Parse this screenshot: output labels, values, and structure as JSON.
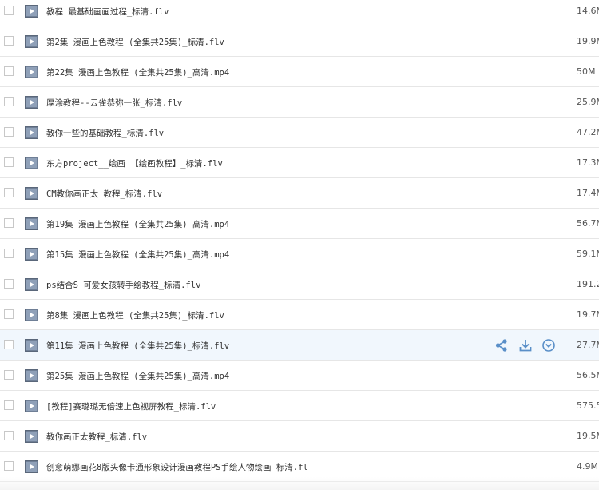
{
  "files": [
    {
      "name": "教程 最基础画画过程_标清.flv",
      "size": "14.6M"
    },
    {
      "name": "第2集 漫画上色教程 (全集共25集)_标清.flv",
      "size": "19.9M"
    },
    {
      "name": "第22集 漫画上色教程 (全集共25集)_高清.mp4",
      "size": "50M"
    },
    {
      "name": "厚涂教程--云雀恭弥一张_标清.flv",
      "size": "25.9M"
    },
    {
      "name": "教你一些的基础教程_标清.flv",
      "size": "47.2M"
    },
    {
      "name": "东方project__绘画 【绘画教程】_标清.flv",
      "size": "17.3M"
    },
    {
      "name": "CM教你画正太 教程_标清.flv",
      "size": "17.4M"
    },
    {
      "name": "第19集 漫画上色教程 (全集共25集)_高清.mp4",
      "size": "56.7M"
    },
    {
      "name": "第15集 漫画上色教程 (全集共25集)_高清.mp4",
      "size": "59.1M"
    },
    {
      "name": "ps结合S 可爱女孩转手绘教程_标清.flv",
      "size": "191.2"
    },
    {
      "name": "第8集 漫画上色教程 (全集共25集)_标清.flv",
      "size": "19.7M"
    },
    {
      "name": "第11集 漫画上色教程 (全集共25集)_标清.flv",
      "size": "27.7M"
    },
    {
      "name": "第25集 漫画上色教程 (全集共25集)_高清.mp4",
      "size": "56.5M"
    },
    {
      "name": "[教程]赛璐璐无倍速上色视屏教程_标清.flv",
      "size": "575.5"
    },
    {
      "name": "教你画正太教程_标清.flv",
      "size": "19.5M"
    },
    {
      "name": "创意萌娜画花8版头像卡通形象设计漫画教程PS手绘人物绘画_标清.fl",
      "size": "4.9M"
    }
  ],
  "hover_row_index": 11,
  "row_actions": [
    "share-icon",
    "download-icon",
    "more-icon"
  ],
  "colors": {
    "accent": "#5a8fc8",
    "hover_bg": "#f1f7fd",
    "border": "#e6e6e6"
  }
}
